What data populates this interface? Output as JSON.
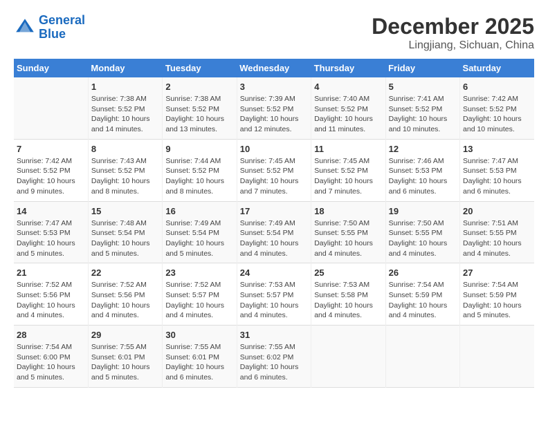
{
  "header": {
    "logo_line1": "General",
    "logo_line2": "Blue",
    "month": "December 2025",
    "location": "Lingjiang, Sichuan, China"
  },
  "weekdays": [
    "Sunday",
    "Monday",
    "Tuesday",
    "Wednesday",
    "Thursday",
    "Friday",
    "Saturday"
  ],
  "weeks": [
    [
      {
        "num": "",
        "info": ""
      },
      {
        "num": "1",
        "info": "Sunrise: 7:38 AM\nSunset: 5:52 PM\nDaylight: 10 hours and 14 minutes."
      },
      {
        "num": "2",
        "info": "Sunrise: 7:38 AM\nSunset: 5:52 PM\nDaylight: 10 hours and 13 minutes."
      },
      {
        "num": "3",
        "info": "Sunrise: 7:39 AM\nSunset: 5:52 PM\nDaylight: 10 hours and 12 minutes."
      },
      {
        "num": "4",
        "info": "Sunrise: 7:40 AM\nSunset: 5:52 PM\nDaylight: 10 hours and 11 minutes."
      },
      {
        "num": "5",
        "info": "Sunrise: 7:41 AM\nSunset: 5:52 PM\nDaylight: 10 hours and 10 minutes."
      },
      {
        "num": "6",
        "info": "Sunrise: 7:42 AM\nSunset: 5:52 PM\nDaylight: 10 hours and 10 minutes."
      }
    ],
    [
      {
        "num": "7",
        "info": "Sunrise: 7:42 AM\nSunset: 5:52 PM\nDaylight: 10 hours and 9 minutes."
      },
      {
        "num": "8",
        "info": "Sunrise: 7:43 AM\nSunset: 5:52 PM\nDaylight: 10 hours and 8 minutes."
      },
      {
        "num": "9",
        "info": "Sunrise: 7:44 AM\nSunset: 5:52 PM\nDaylight: 10 hours and 8 minutes."
      },
      {
        "num": "10",
        "info": "Sunrise: 7:45 AM\nSunset: 5:52 PM\nDaylight: 10 hours and 7 minutes."
      },
      {
        "num": "11",
        "info": "Sunrise: 7:45 AM\nSunset: 5:52 PM\nDaylight: 10 hours and 7 minutes."
      },
      {
        "num": "12",
        "info": "Sunrise: 7:46 AM\nSunset: 5:53 PM\nDaylight: 10 hours and 6 minutes."
      },
      {
        "num": "13",
        "info": "Sunrise: 7:47 AM\nSunset: 5:53 PM\nDaylight: 10 hours and 6 minutes."
      }
    ],
    [
      {
        "num": "14",
        "info": "Sunrise: 7:47 AM\nSunset: 5:53 PM\nDaylight: 10 hours and 5 minutes."
      },
      {
        "num": "15",
        "info": "Sunrise: 7:48 AM\nSunset: 5:54 PM\nDaylight: 10 hours and 5 minutes."
      },
      {
        "num": "16",
        "info": "Sunrise: 7:49 AM\nSunset: 5:54 PM\nDaylight: 10 hours and 5 minutes."
      },
      {
        "num": "17",
        "info": "Sunrise: 7:49 AM\nSunset: 5:54 PM\nDaylight: 10 hours and 4 minutes."
      },
      {
        "num": "18",
        "info": "Sunrise: 7:50 AM\nSunset: 5:55 PM\nDaylight: 10 hours and 4 minutes."
      },
      {
        "num": "19",
        "info": "Sunrise: 7:50 AM\nSunset: 5:55 PM\nDaylight: 10 hours and 4 minutes."
      },
      {
        "num": "20",
        "info": "Sunrise: 7:51 AM\nSunset: 5:55 PM\nDaylight: 10 hours and 4 minutes."
      }
    ],
    [
      {
        "num": "21",
        "info": "Sunrise: 7:52 AM\nSunset: 5:56 PM\nDaylight: 10 hours and 4 minutes."
      },
      {
        "num": "22",
        "info": "Sunrise: 7:52 AM\nSunset: 5:56 PM\nDaylight: 10 hours and 4 minutes."
      },
      {
        "num": "23",
        "info": "Sunrise: 7:52 AM\nSunset: 5:57 PM\nDaylight: 10 hours and 4 minutes."
      },
      {
        "num": "24",
        "info": "Sunrise: 7:53 AM\nSunset: 5:57 PM\nDaylight: 10 hours and 4 minutes."
      },
      {
        "num": "25",
        "info": "Sunrise: 7:53 AM\nSunset: 5:58 PM\nDaylight: 10 hours and 4 minutes."
      },
      {
        "num": "26",
        "info": "Sunrise: 7:54 AM\nSunset: 5:59 PM\nDaylight: 10 hours and 4 minutes."
      },
      {
        "num": "27",
        "info": "Sunrise: 7:54 AM\nSunset: 5:59 PM\nDaylight: 10 hours and 5 minutes."
      }
    ],
    [
      {
        "num": "28",
        "info": "Sunrise: 7:54 AM\nSunset: 6:00 PM\nDaylight: 10 hours and 5 minutes."
      },
      {
        "num": "29",
        "info": "Sunrise: 7:55 AM\nSunset: 6:01 PM\nDaylight: 10 hours and 5 minutes."
      },
      {
        "num": "30",
        "info": "Sunrise: 7:55 AM\nSunset: 6:01 PM\nDaylight: 10 hours and 6 minutes."
      },
      {
        "num": "31",
        "info": "Sunrise: 7:55 AM\nSunset: 6:02 PM\nDaylight: 10 hours and 6 minutes."
      },
      {
        "num": "",
        "info": ""
      },
      {
        "num": "",
        "info": ""
      },
      {
        "num": "",
        "info": ""
      }
    ]
  ]
}
